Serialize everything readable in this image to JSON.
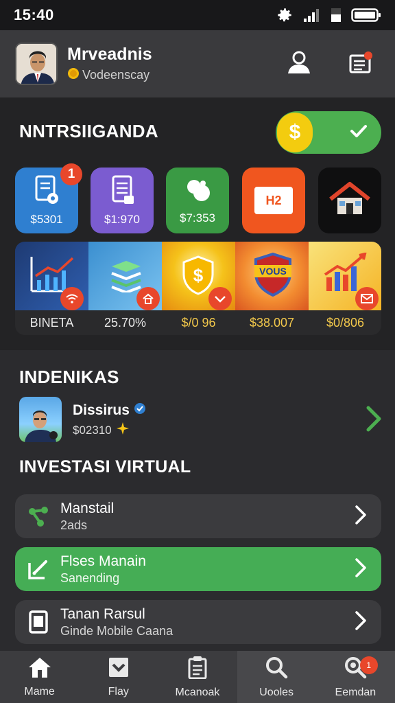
{
  "status": {
    "time": "15:40"
  },
  "header": {
    "name": "Mrveadnis",
    "subtitle": "Vodeenscay"
  },
  "section1": {
    "title": "NNTRSIIGANDA",
    "toggle": {
      "on": true,
      "knob_symbol": "$"
    },
    "tiles": [
      {
        "value": "$5301",
        "color": "#2f7fd0",
        "badge": "1",
        "icon": "document-icon"
      },
      {
        "value": "$1:970",
        "color": "#7b5cd0",
        "icon": "clipboard-icon"
      },
      {
        "value": "$7:353",
        "color": "#3a9a44",
        "icon": "coins-icon"
      },
      {
        "value": "",
        "color": "#f0561f",
        "icon": "calendar-icon",
        "icon_text": "H2"
      },
      {
        "value": "",
        "color": "#101010",
        "icon": "home-icon"
      }
    ],
    "strip": [
      {
        "value": "BINETA",
        "icon": "growth-chart-icon"
      },
      {
        "value": "25.70%",
        "icon": "stack-icon"
      },
      {
        "value": "$/0 96",
        "icon": "shield-dollar-icon"
      },
      {
        "value": "$38.007",
        "icon": "vous-badge-icon",
        "badge_text": "VOUS"
      },
      {
        "value": "$0/806",
        "icon": "bar-chart-icon"
      }
    ]
  },
  "section2": {
    "title": "INDENIKAS",
    "person": {
      "name": "Dissirus",
      "value": "$02310"
    },
    "subtitle": "INVESTASI VIRTUAL",
    "items": [
      {
        "title": "Manstail",
        "sub": "2ads",
        "icon": "share-icon"
      },
      {
        "title": "Flses Manain",
        "sub": "Sanending",
        "icon": "edit-icon"
      },
      {
        "title": "Tanan Rarsul",
        "sub": "Ginde Mobile Caana",
        "icon": "tablet-icon"
      }
    ]
  },
  "nav": [
    {
      "label": "Mame",
      "icon": "home-icon"
    },
    {
      "label": "Flay",
      "icon": "inbox-icon"
    },
    {
      "label": "Mcanoak",
      "icon": "clipboard-icon"
    },
    {
      "label": "Uooles",
      "icon": "search-icon"
    },
    {
      "label": "Eemdan",
      "icon": "search-badge-icon",
      "badge": "1"
    }
  ]
}
